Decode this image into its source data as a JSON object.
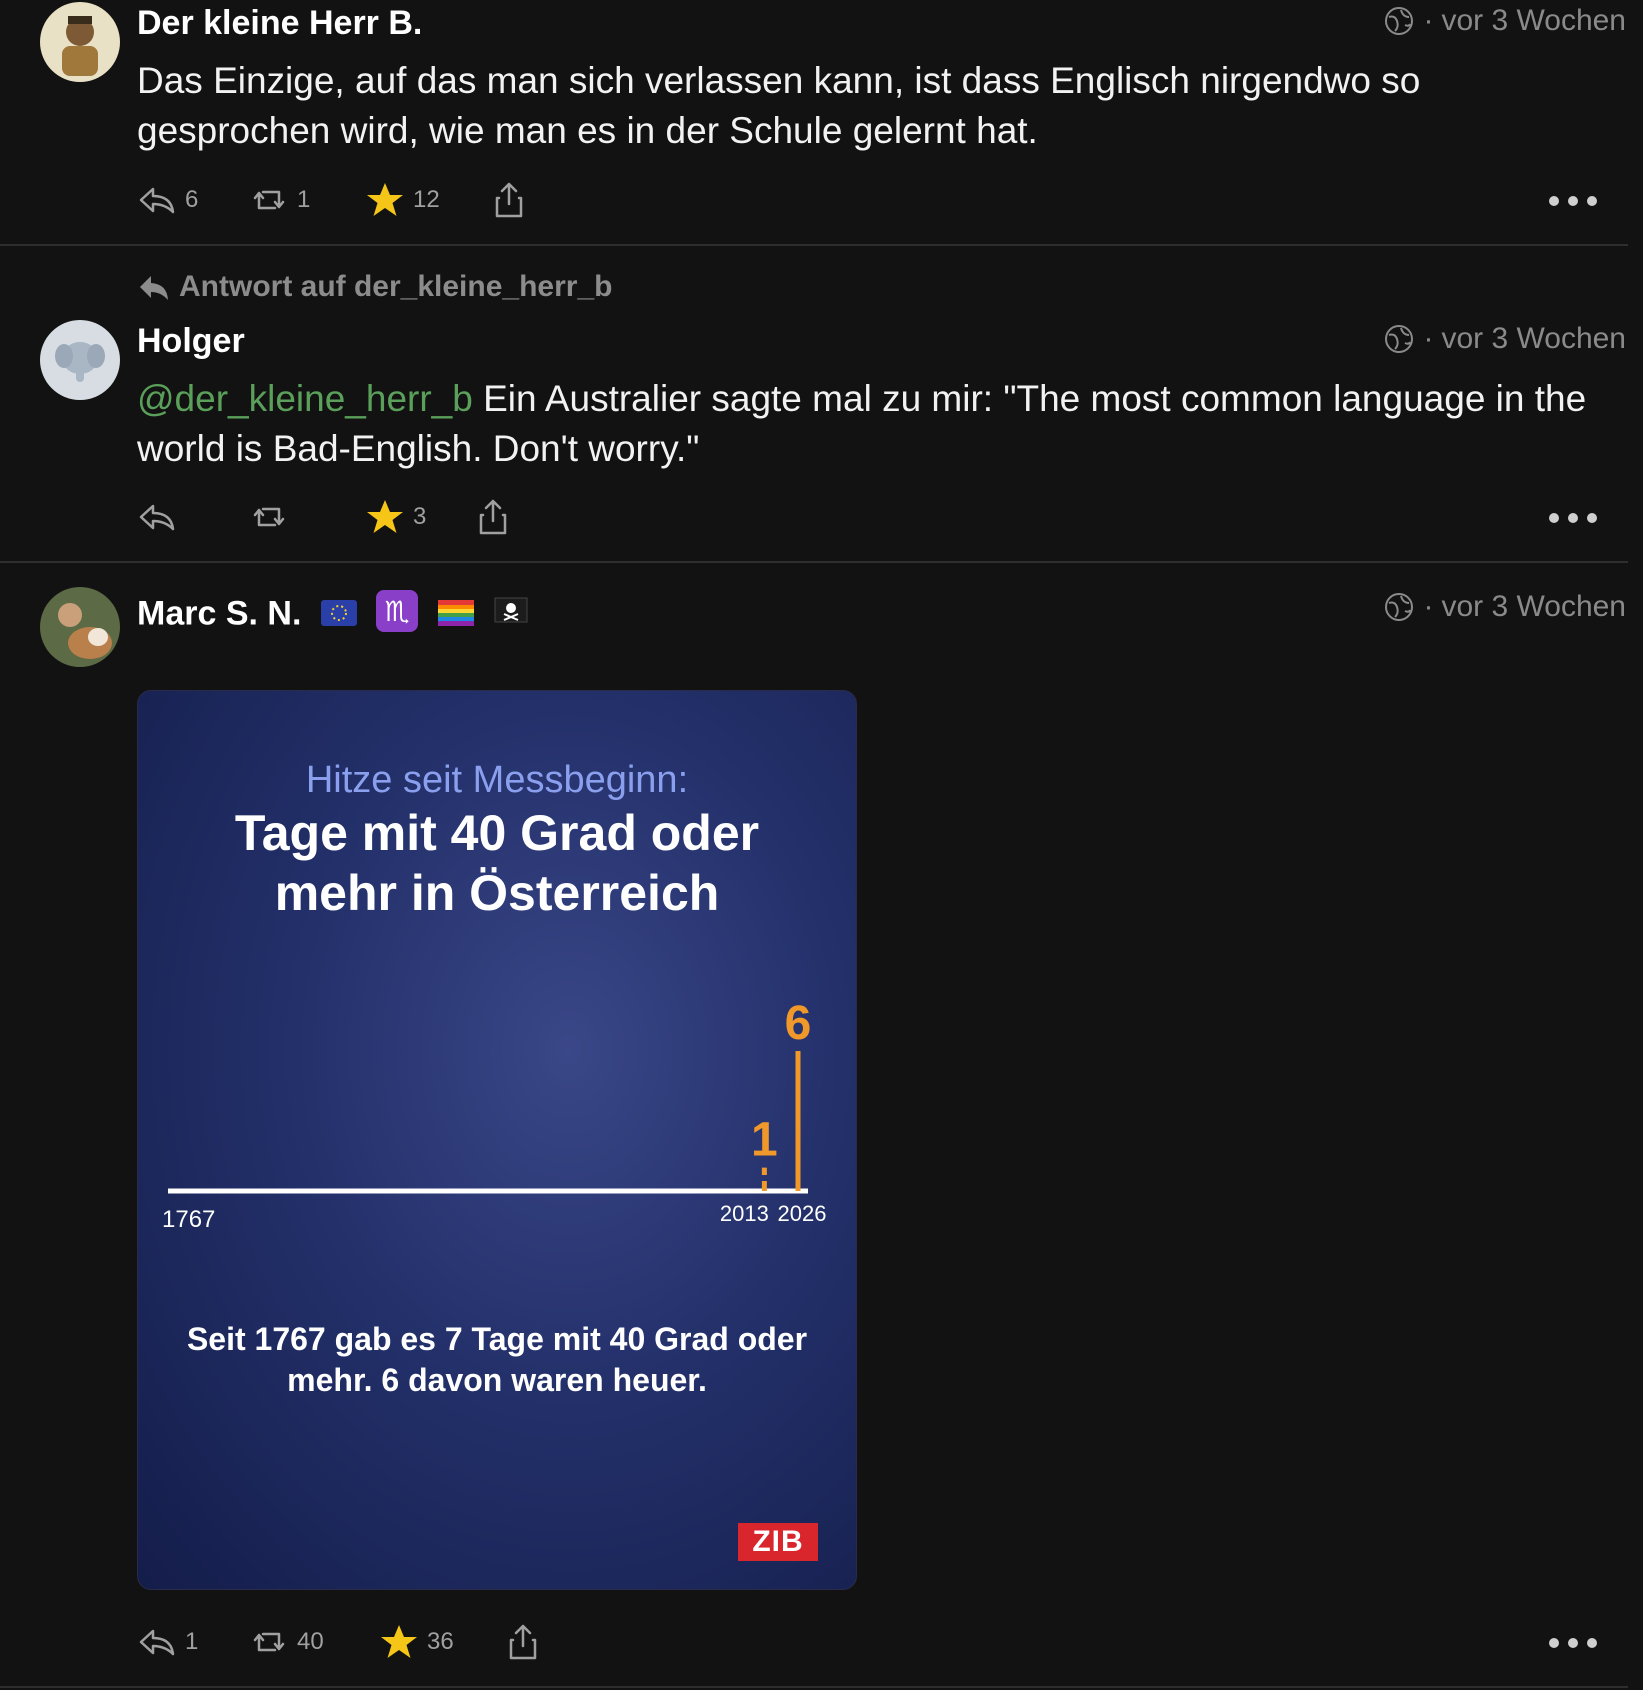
{
  "posts": [
    {
      "author": "Der kleine Herr B.",
      "time": "vor 3 Wochen",
      "text": "Das Einzige, auf das man sich verlassen kann, ist dass Englisch nirgendwo so gesprochen wird, wie man es in der Schule gelernt hat.",
      "replies": "6",
      "boosts": "1",
      "favourites": "12"
    },
    {
      "reply_context": "Antwort auf der_kleine_herr_b",
      "author": "Holger",
      "time": "vor 3 Wochen",
      "mention": "@der_kleine_herr_b",
      "text": " Ein Australier sagte mal zu mir: \"The most common language in the world is Bad-English. Don't worry.\"",
      "replies": "",
      "boosts": "",
      "favourites": "3"
    },
    {
      "author": "Marc S. N.",
      "author_badges": [
        "eu-flag",
        "scorpio-sign",
        "rainbow-flag",
        "pirate-flag"
      ],
      "time": "vor 3 Wochen",
      "replies": "1",
      "boosts": "40",
      "favourites": "36"
    }
  ],
  "chart_data": {
    "type": "bar",
    "subtitle": "Hitze seit Messbeginn:",
    "title": "Tage mit 40 Grad oder mehr in Österreich",
    "x_start": "1767",
    "x_end": "2026",
    "x": [
      "2013",
      "2026"
    ],
    "values": [
      1,
      6
    ],
    "value_labels": [
      "1",
      "6"
    ],
    "footnote": "Seit 1767 gab es 7 Tage mit 40 Grad oder mehr. 6 davon waren heuer.",
    "source": "ZIB",
    "colors": {
      "accent": "#f0982a",
      "axis": "#ffffff",
      "background": "#23306a"
    }
  },
  "colors": {
    "background": "#121212",
    "mention": "#5aa05a",
    "muted": "#8a8a8a",
    "star": "#f5c518"
  }
}
